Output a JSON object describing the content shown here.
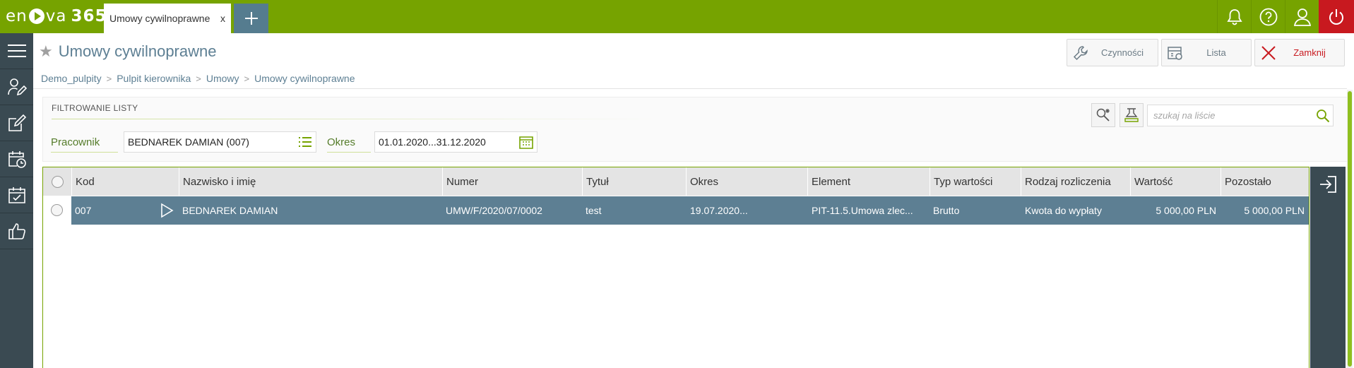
{
  "app": {
    "logo": {
      "en": "en",
      "va": "va",
      "n365": "365"
    },
    "tab_title": "Umowy cywilnoprawne",
    "tab_close": "x",
    "add_tab": "+",
    "top_icons": [
      "bell-icon",
      "help-icon",
      "user-icon",
      "power-icon"
    ]
  },
  "sidebar": {
    "items": [
      "menu-icon",
      "user-edit-icon",
      "edit-icon",
      "calendar-clock-icon",
      "calendar-check-icon",
      "thumbs-up-icon"
    ]
  },
  "header": {
    "title": "Umowy cywilnoprawne",
    "star": "★",
    "buttons": {
      "czynnosci": "Czynności",
      "lista": "Lista",
      "zamknij": "Zamknij"
    }
  },
  "breadcrumb": [
    "Demo_pulpity",
    "Pulpit kierownika",
    "Umowy",
    "Umowy cywilnoprawne"
  ],
  "breadcrumb_sep": ">",
  "filter": {
    "title": "FILTROWANIE LISTY",
    "pracownik_label": "Pracownik",
    "pracownik_value": "BEDNAREK DAMIAN (007)",
    "okres_label": "Okres",
    "okres_value": "01.01.2020...31.12.2020",
    "search_placeholder": "szukaj na liście"
  },
  "grid": {
    "columns": [
      "Kod",
      "Nazwisko i imię",
      "Numer",
      "Tytuł",
      "Okres",
      "Element",
      "Typ wartości",
      "Rodzaj rozliczenia",
      "Wartość",
      "Pozostało"
    ],
    "rows": [
      {
        "kod": "007",
        "nazwisko": "BEDNAREK DAMIAN",
        "numer": "UMW/F/2020/07/0002",
        "tytul": "test",
        "okres": "19.07.2020...",
        "element": "PIT-11.5.Umowa zlec...",
        "typ": "Brutto",
        "rodzaj": "Kwota do wypłaty",
        "wartosc": "5 000,00 PLN",
        "pozostalo": "5 000,00 PLN"
      }
    ]
  },
  "colors": {
    "brand_green": "#76a300",
    "selected_row": "#5d7f93",
    "sidebar": "#3a4a52",
    "close_red": "#c8191f"
  }
}
